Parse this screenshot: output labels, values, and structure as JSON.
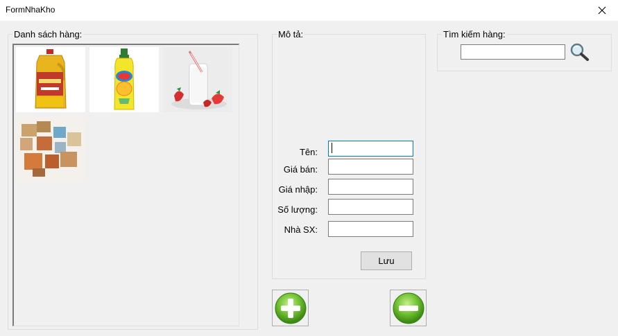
{
  "window": {
    "title": "FormNhaKho",
    "close_glyph": "✕"
  },
  "product_list": {
    "label": "Danh sách hàng:",
    "items": [
      {
        "icon": "cooking-oil-bottle"
      },
      {
        "icon": "dish-soap-bottle"
      },
      {
        "icon": "yogurt-strawberries"
      },
      {
        "icon": "soap-bars"
      }
    ]
  },
  "description": {
    "label": "Mô tả:",
    "fields": {
      "name": {
        "label": "Tên:",
        "value": ""
      },
      "sale_price": {
        "label": "Giá bán:",
        "value": ""
      },
      "import_price": {
        "label": "Giá nhập:",
        "value": ""
      },
      "quantity": {
        "label": "Số lượng:",
        "value": ""
      },
      "manufacturer": {
        "label": "Nhà SX:",
        "value": ""
      }
    },
    "save_label": "Lưu"
  },
  "actions": {
    "add_icon": "plus-icon",
    "remove_icon": "minus-icon"
  },
  "search": {
    "label": "Tìm kiếm hàng:",
    "value": "",
    "icon": "magnifier-icon"
  },
  "colors": {
    "button_green": "#5db02d",
    "focus_border": "#0078d7"
  }
}
